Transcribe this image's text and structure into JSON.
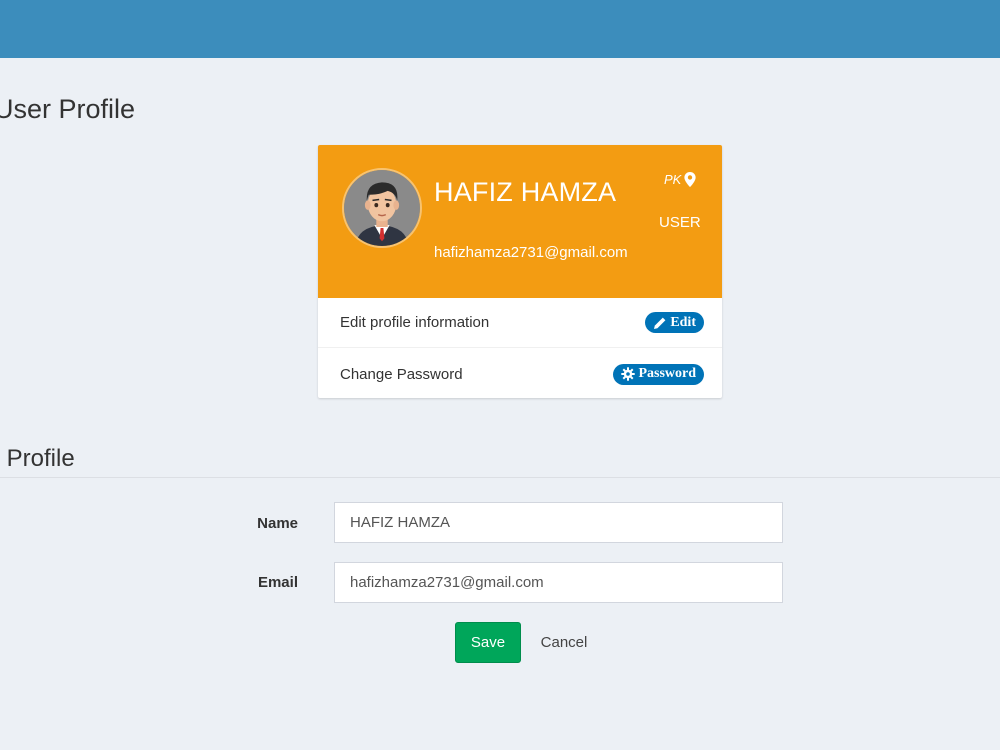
{
  "header": {
    "page_title": "User Profile"
  },
  "profile_card": {
    "name": "HAFIZ HAMZA",
    "email": "hafizhamza2731@gmail.com",
    "country": "PK",
    "role": "USER",
    "rows": [
      {
        "label": "Edit profile information",
        "action_label": "Edit",
        "action_icon": "pencil-icon"
      },
      {
        "label": "Change Password",
        "action_label": "Password",
        "action_icon": "gear-icon"
      }
    ]
  },
  "edit_section": {
    "title": "it Profile",
    "fields": {
      "name": {
        "label": "Name",
        "value": "HAFIZ HAMZA"
      },
      "email": {
        "label": "Email",
        "value": "hafizhamza2731@gmail.com"
      }
    },
    "save_label": "Save",
    "cancel_label": "Cancel"
  },
  "colors": {
    "topbar": "#3c8dbc",
    "card_header": "#f39c12",
    "pill": "#0073b7",
    "save": "#00a65a",
    "background": "#ecf0f5"
  }
}
